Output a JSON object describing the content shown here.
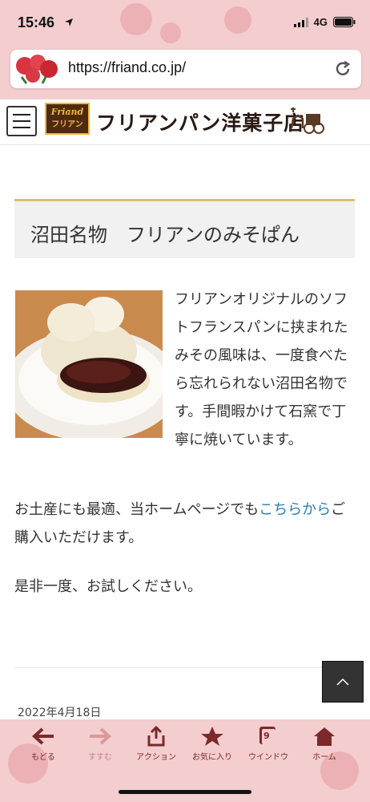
{
  "status_bar": {
    "time": "15:46",
    "network": "4G"
  },
  "browser": {
    "url": "https://friand.co.jp/"
  },
  "site": {
    "logo_badge_top": "Friand",
    "logo_badge_bottom": "フリアン",
    "logo_title": "フリアンパン洋菓子店"
  },
  "article": {
    "title": "沼田名物　フリアンのみそぱん",
    "intro": "フリアンオリジナルのソフトフランスパンに挟まれたみその風味は、一度食べたら忘れられない沼田名物です。手間暇かけて石窯で丁寧に焼いています。",
    "purchase_prefix": "お土産にも最適、当ホームページでも",
    "purchase_link": "こちらから",
    "purchase_suffix": "ご購入いただけます。",
    "closing": "是非一度、お試しください。",
    "date": "2022年4月18日"
  },
  "toolbar": {
    "items": [
      {
        "label": "もどる",
        "icon": "back-arrow-icon"
      },
      {
        "label": "すすむ",
        "icon": "forward-arrow-icon"
      },
      {
        "label": "アクション",
        "icon": "share-icon"
      },
      {
        "label": "お気に入り",
        "icon": "star-icon"
      },
      {
        "label": "ウインドウ",
        "icon": "windows-icon",
        "count": "9"
      },
      {
        "label": "ホーム",
        "icon": "home-icon"
      }
    ]
  },
  "colors": {
    "accent_gold": "#dcc06b",
    "link": "#2c7fb5",
    "toolbar_pink": "#f4cdcf"
  }
}
